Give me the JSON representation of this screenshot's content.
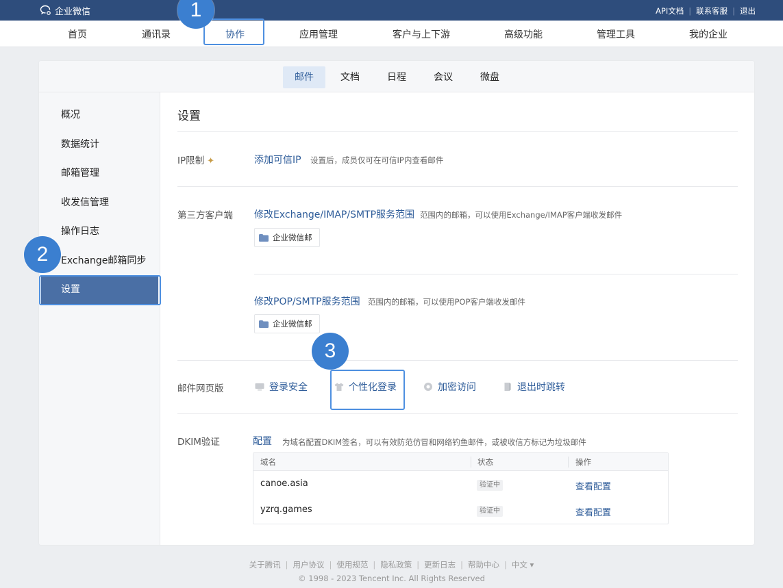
{
  "app": {
    "logo_text": "企业微信",
    "top_links": [
      "API文档",
      "联系客服",
      "退出"
    ]
  },
  "main_nav": {
    "items": [
      "首页",
      "通讯录",
      "协作",
      "应用管理",
      "客户与上下游",
      "高级功能",
      "管理工具",
      "我的企业"
    ],
    "active": "协作"
  },
  "sub_nav": {
    "items": [
      "邮件",
      "文档",
      "日程",
      "会议",
      "微盘"
    ],
    "active": "邮件"
  },
  "sidebar": {
    "items": [
      "概况",
      "数据统计",
      "邮箱管理",
      "收发信管理",
      "操作日志",
      "Exchange邮箱同步",
      "设置"
    ],
    "active": "设置"
  },
  "settings": {
    "title": "设置",
    "ip_limit": {
      "label": "IP限制",
      "link": "添加可信IP",
      "hint": "设置后，成员仅可在可信IP内查看邮件"
    },
    "third_party": {
      "label": "第三方客户端",
      "exchange_link": "修改Exchange/IMAP/SMTP服务范围",
      "exchange_hint": "范围内的邮箱，可以使用Exchange/IMAP客户端收发邮件",
      "exchange_scope": "企业微信邮",
      "pop_link": "修改POP/SMTP服务范围",
      "pop_hint": "范围内的邮箱，可以使用POP客户端收发邮件",
      "pop_scope": "企业微信邮"
    },
    "web_mail": {
      "label": "邮件网页版",
      "options": [
        "登录安全",
        "个性化登录",
        "加密访问",
        "退出时跳转"
      ]
    },
    "dkim": {
      "label": "DKIM验证",
      "link": "配置",
      "hint": "为域名配置DKIM签名，可以有效防范仿冒和网络钓鱼邮件，或被收信方标记为垃圾邮件",
      "columns": [
        "域名",
        "状态",
        "操作"
      ],
      "rows": [
        {
          "domain": "canoe.asia",
          "status": "验证中",
          "action": "查看配置"
        },
        {
          "domain": "yzrq.games",
          "status": "验证中",
          "action": "查看配置"
        }
      ]
    }
  },
  "footer": {
    "links": [
      "关于腾讯",
      "用户协议",
      "使用规范",
      "隐私政策",
      "更新日志",
      "帮助中心",
      "中文 ▾"
    ],
    "copyright": "© 1998 - 2023 Tencent Inc. All Rights Reserved"
  },
  "annotations": {
    "badges": [
      "1",
      "2",
      "3"
    ]
  },
  "colors": {
    "topbar": "#2e4d7c",
    "accent": "#2f5d9a",
    "sidebar_active": "#4a6fa5",
    "badge": "#3b7fd0"
  }
}
